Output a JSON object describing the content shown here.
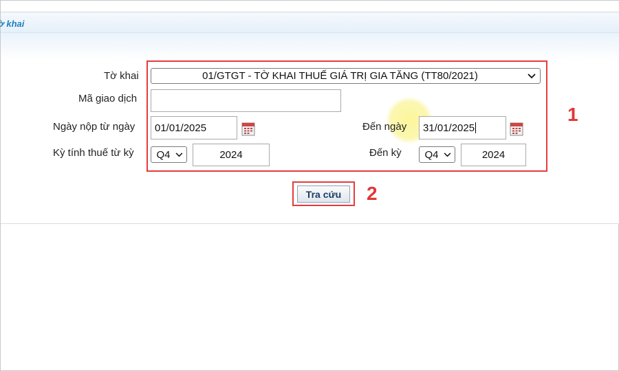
{
  "header": {
    "title": "ờ khai"
  },
  "form": {
    "to_khai": {
      "label": "Tờ khai",
      "value": "01/GTGT - TỜ KHAI THUẾ GIÁ TRỊ GIA TĂNG (TT80/2021)"
    },
    "ma_giao_dich": {
      "label": "Mã giao dịch",
      "value": ""
    },
    "ngay_nop_tu": {
      "label": "Ngày nộp từ ngày",
      "value": "01/01/2025"
    },
    "den_ngay": {
      "label": "Đến ngày",
      "value": "31/01/2025"
    },
    "ky_tinh_thue_tu": {
      "label": "Kỳ tính thuế từ kỳ",
      "quarter": "Q4",
      "year": "2024"
    },
    "den_ky": {
      "label": "Đến kỳ",
      "quarter": "Q4",
      "year": "2024"
    }
  },
  "search_button": {
    "label": "Tra cứu"
  },
  "annotations": {
    "form_marker": "1",
    "button_marker": "2"
  },
  "colors": {
    "annotation_red": "#e43b3b",
    "header_text": "#1e7fbe"
  },
  "icons": {
    "calendar": "calendar-icon",
    "dropdown": "chevron-down-icon"
  }
}
